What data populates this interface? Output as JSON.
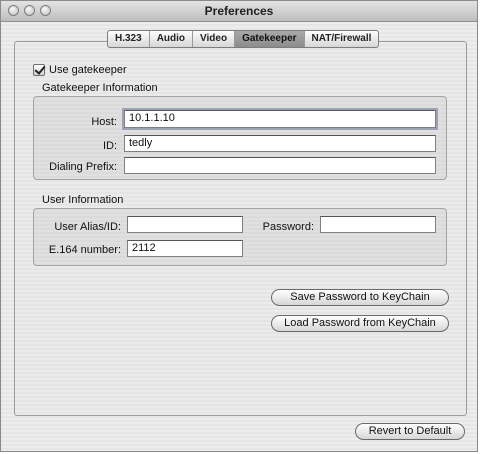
{
  "window": {
    "title": "Preferences"
  },
  "tabs": [
    {
      "label": "H.323",
      "selected": false
    },
    {
      "label": "Audio",
      "selected": false
    },
    {
      "label": "Video",
      "selected": false
    },
    {
      "label": "Gatekeeper",
      "selected": true
    },
    {
      "label": "NAT/Firewall",
      "selected": false
    }
  ],
  "gatekeeper": {
    "use_label": "Use gatekeeper",
    "use_checked": true,
    "section_title": "Gatekeeper Information",
    "host_label": "Host:",
    "host_value": "10.1.1.10",
    "id_label": "ID:",
    "id_value": "tedly",
    "prefix_label": "Dialing Prefix:",
    "prefix_value": ""
  },
  "user": {
    "section_title": "User Information",
    "alias_label": "User Alias/ID:",
    "alias_value": "",
    "password_label": "Password:",
    "password_value": "",
    "e164_label": "E.164 number:",
    "e164_value": "2112"
  },
  "buttons": {
    "save_keychain": "Save Password to KeyChain",
    "load_keychain": "Load Password from KeyChain",
    "revert": "Revert to Default"
  }
}
